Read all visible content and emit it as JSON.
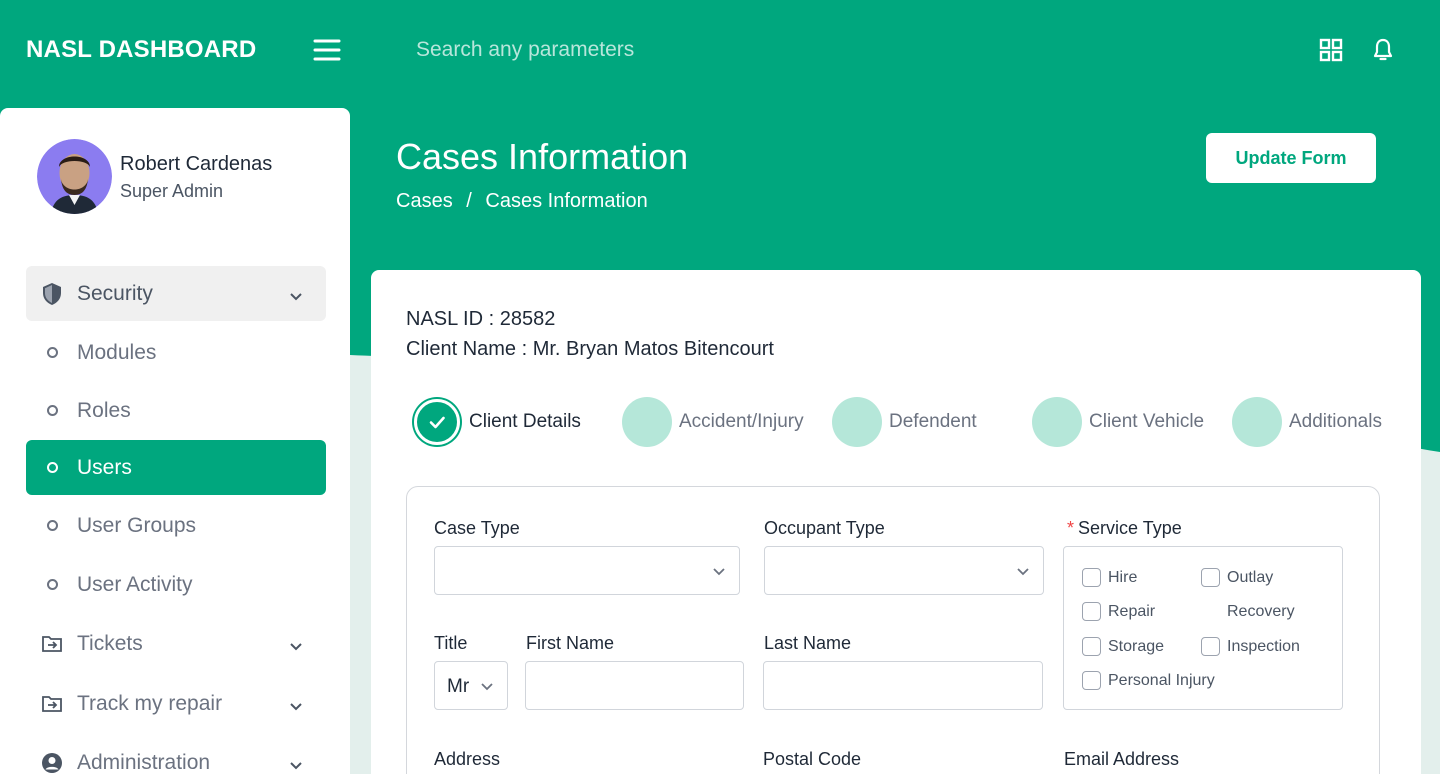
{
  "colors": {
    "brand": "#00a77e",
    "step_pending": "#b5e7d9",
    "background": "#e3efec"
  },
  "topbar": {
    "brand": "NASL DASHBOARD",
    "search_placeholder": "Search any parameters",
    "icons": [
      "menu-icon",
      "grid-icon",
      "bell-icon"
    ]
  },
  "user": {
    "name": "Robert Cardenas",
    "role": "Super Admin"
  },
  "sidebar": {
    "items": [
      {
        "label": "Security",
        "icon": "shield-icon",
        "expanded": true
      },
      {
        "label": "Modules",
        "icon": "bullet"
      },
      {
        "label": "Roles",
        "icon": "bullet"
      },
      {
        "label": "Users",
        "icon": "bullet",
        "active": true
      },
      {
        "label": "User Groups",
        "icon": "bullet"
      },
      {
        "label": "User Activity",
        "icon": "bullet"
      },
      {
        "label": "Tickets",
        "icon": "folder-arrow-icon"
      },
      {
        "label": "Track my repair",
        "icon": "folder-arrow-icon"
      },
      {
        "label": "Administration",
        "icon": "user-circle-icon"
      }
    ]
  },
  "header": {
    "title": "Cases Information",
    "breadcrumb": [
      "Cases",
      "/",
      "Cases Information"
    ],
    "update_button": "Update Form"
  },
  "case": {
    "nasl_id": "NASL ID : 28582",
    "client_name": "Client Name : Mr. Bryan Matos Bitencourt"
  },
  "steps": [
    {
      "label": "Client Details",
      "done": true
    },
    {
      "label": "Accident/Injury"
    },
    {
      "label": "Defendent"
    },
    {
      "label": "Client Vehicle"
    },
    {
      "label": "Additionals"
    }
  ],
  "form": {
    "case_type": {
      "label": "Case Type",
      "value": ""
    },
    "occupant_type": {
      "label": "Occupant Type",
      "value": ""
    },
    "service_type": {
      "required_mark": "*",
      "label": "Service Type",
      "options": {
        "hire": "Hire",
        "outlay": "Outlay",
        "recovery": "Recovery",
        "repair": "Repair",
        "storage": "Storage",
        "inspection": "Inspection",
        "personal_injury": "Personal Injury"
      }
    },
    "title": {
      "label": "Title",
      "value": "Mr"
    },
    "first_name": {
      "label": "First Name",
      "value": ""
    },
    "last_name": {
      "label": "Last Name",
      "value": ""
    },
    "address": {
      "label": "Address"
    },
    "postal_code": {
      "label": "Postal Code"
    },
    "email": {
      "label": "Email Address"
    }
  }
}
